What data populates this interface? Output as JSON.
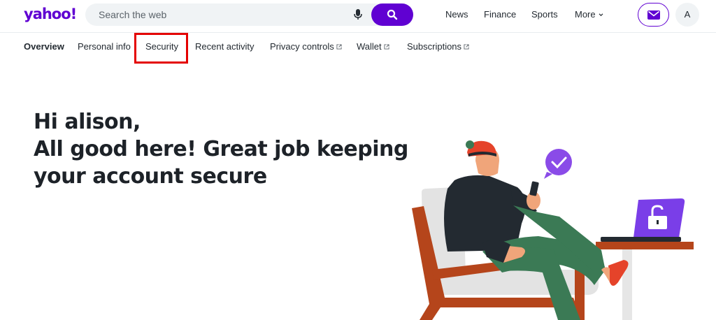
{
  "header": {
    "logo": "yahoo!",
    "search_placeholder": "Search the web",
    "nav": [
      "News",
      "Finance",
      "Sports",
      "More"
    ],
    "avatar_initial": "A"
  },
  "tabs": [
    {
      "label": "Overview",
      "active": true,
      "external": false
    },
    {
      "label": "Personal info",
      "active": false,
      "external": false
    },
    {
      "label": "Security",
      "active": false,
      "external": false
    },
    {
      "label": "Recent activity",
      "active": false,
      "external": false
    },
    {
      "label": "Privacy controls",
      "active": false,
      "external": true
    },
    {
      "label": "Wallet",
      "active": false,
      "external": true
    },
    {
      "label": "Subscriptions",
      "active": false,
      "external": true
    }
  ],
  "hero": {
    "line1": "Hi alison,",
    "line2": "All good here! Great job keeping",
    "line3": "your account secure"
  },
  "colors": {
    "brand": "#6001d2",
    "highlight": "#e40000",
    "chair": "#b5451b",
    "laptop": "#7a3ee8"
  },
  "icons": [
    "mic-icon",
    "search-icon",
    "mail-icon",
    "external-link-icon",
    "checkmark-icon",
    "lock-icon"
  ]
}
